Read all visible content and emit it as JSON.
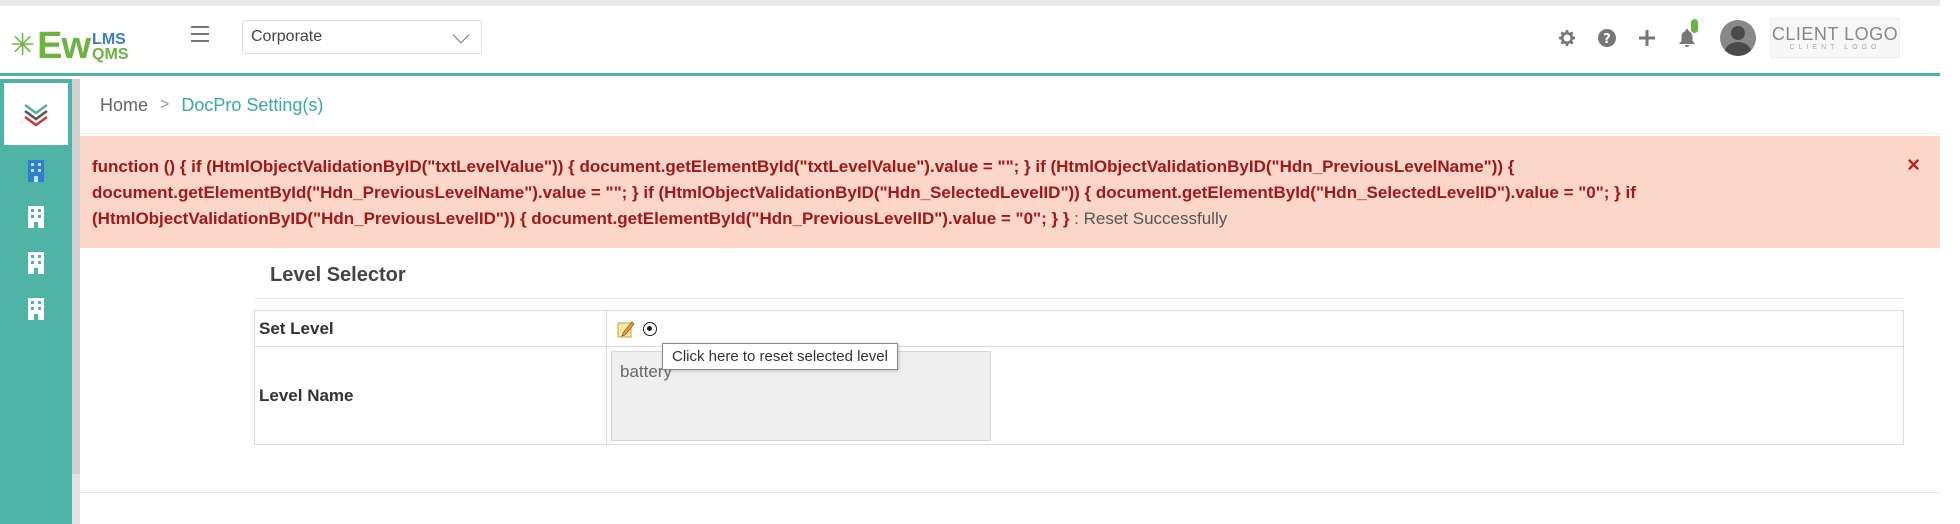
{
  "app": {
    "logo_main": "Ew",
    "logo_top": "LMS",
    "logo_bottom": "QMS",
    "brand_colors": {
      "teal": "#4fb4a6",
      "green": "#6cb33f",
      "blue": "#3d7cc9"
    }
  },
  "header": {
    "org_select_value": "Corporate",
    "icons": [
      "gear-icon",
      "help-icon",
      "plus-icon",
      "bell-icon",
      "avatar"
    ],
    "client_logo_main": "CLIENT LOGO",
    "client_logo_sub": "CLIENT LOGO"
  },
  "sidebar": {
    "items": [
      "collapse-toggle",
      "building-icon-active",
      "building-icon",
      "building-icon",
      "building-icon"
    ]
  },
  "breadcrumb": {
    "home": "Home",
    "separator": ">",
    "current": "DocPro Setting(s)"
  },
  "alert": {
    "error_text": "function () { if (HtmlObjectValidationByID(\"txtLevelValue\")) { document.getElementById(\"txtLevelValue\").value = \"\"; } if (HtmlObjectValidationByID(\"Hdn_PreviousLevelName\")) { document.getElementById(\"Hdn_PreviousLevelName\").value = \"\"; } if (HtmlObjectValidationByID(\"Hdn_SelectedLevelID\")) { document.getElementById(\"Hdn_SelectedLevelID\").value = \"0\"; } if (HtmlObjectValidationByID(\"Hdn_PreviousLevelID\")) { document.getElementById(\"Hdn_PreviousLevelID\").value = \"0\"; } }",
    "message": " : Reset Successfully",
    "close": "×",
    "bg_color": "#fbd6c9"
  },
  "panel": {
    "title": "Level Selector",
    "set_level_label": "Set Level",
    "level_name_label": "Level Name",
    "level_name_value": "battery",
    "tooltip": "Click here to reset selected level"
  }
}
